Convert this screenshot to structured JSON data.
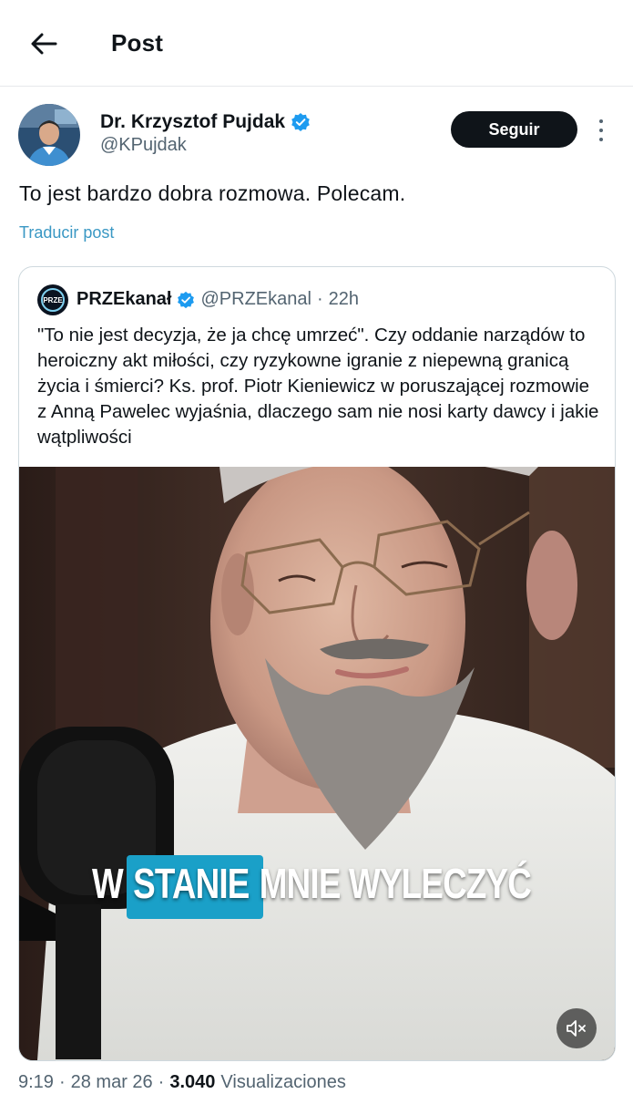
{
  "header": {
    "title": "Post"
  },
  "author": {
    "name": "Dr. Krzysztof Pujdak",
    "handle": "@KPujdak",
    "follow_label": "Seguir",
    "verified": true
  },
  "post": {
    "text": "To jest bardzo dobra rozmowa. Polecam.",
    "translate_label": "Traducir post"
  },
  "quoted": {
    "avatar_text": "PRZE",
    "name": "PRZEkanał",
    "handle": "@PRZEkanal",
    "separator": "·",
    "time": "22h",
    "text": "\"To nie jest decyzja, że ja chcę umrzeć\". Czy oddanie narządów to heroiczny akt miłości, czy ryzykowne igranie z niepewną granicą życia i śmierci? Ks. prof. Piotr Kieniewicz w poruszającej rozmowie z Anną Pawelec wyjaśnia, dlaczego sam nie nosi karty dawcy i jakie wątpliwości",
    "video": {
      "caption_word1": "W",
      "caption_word2": "STANIE",
      "caption_word3": "MNIE WYLECZYĆ",
      "mute_icon": "speaker-muted-icon"
    }
  },
  "meta": {
    "time": "9:19",
    "sep1": "·",
    "date": "28 mar 26",
    "sep2": "·",
    "views_count": "3.040",
    "views_label": "Visualizaciones"
  },
  "colors": {
    "verified": "#1d9bf0",
    "caption_highlight": "#1aa0c8",
    "follow_bg": "#0f1419"
  }
}
